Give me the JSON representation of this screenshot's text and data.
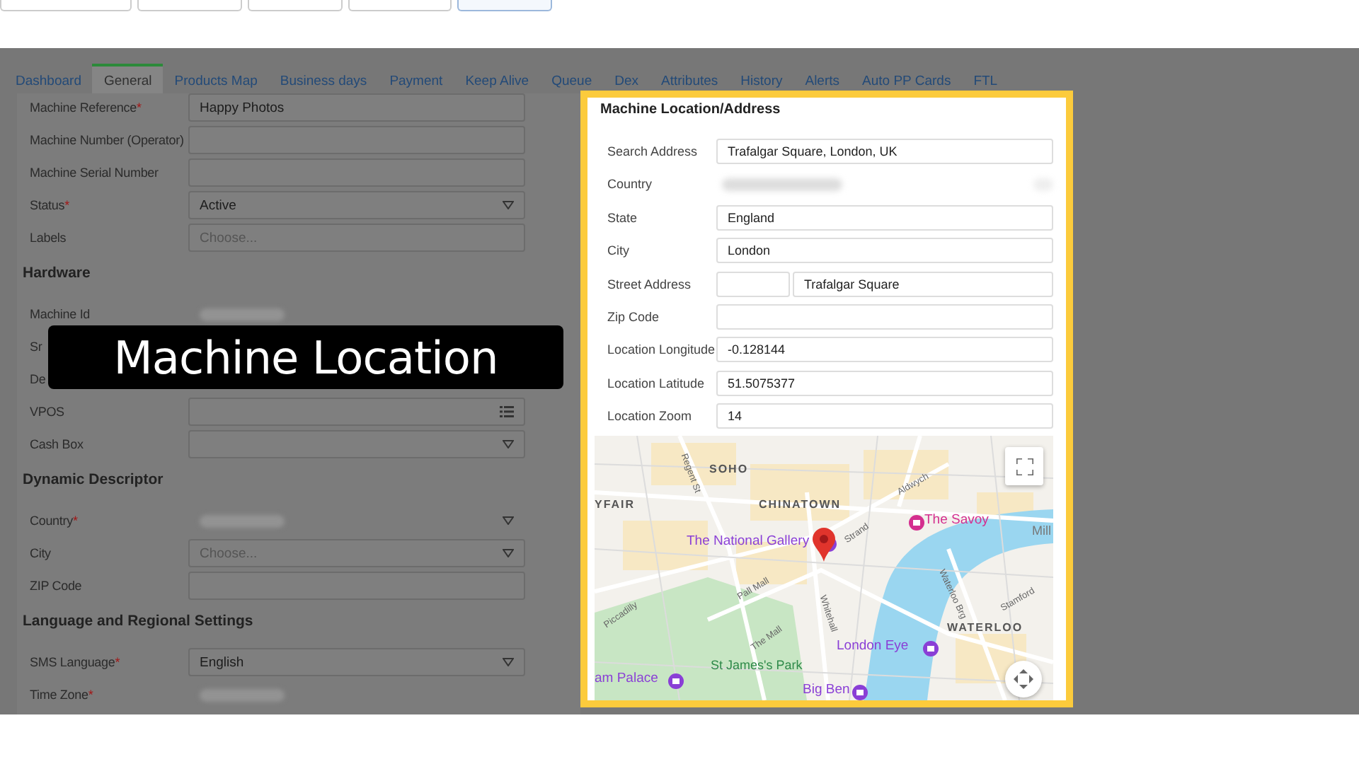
{
  "toolbar_buttons": [
    {
      "selected": false
    },
    {
      "selected": false
    },
    {
      "selected": false
    },
    {
      "selected": false
    },
    {
      "selected": true
    }
  ],
  "tabs": [
    {
      "label": "Dashboard",
      "selected": false
    },
    {
      "label": "General",
      "selected": true
    },
    {
      "label": "Products Map",
      "selected": false
    },
    {
      "label": "Business days",
      "selected": false
    },
    {
      "label": "Payment",
      "selected": false
    },
    {
      "label": "Keep Alive",
      "selected": false
    },
    {
      "label": "Queue",
      "selected": false
    },
    {
      "label": "Dex",
      "selected": false
    },
    {
      "label": "Attributes",
      "selected": false
    },
    {
      "label": "History",
      "selected": false
    },
    {
      "label": "Alerts",
      "selected": false
    },
    {
      "label": "Auto PP Cards",
      "selected": false
    },
    {
      "label": "FTL",
      "selected": false
    }
  ],
  "form": {
    "sections": [
      {
        "fields": [
          {
            "label": "Machine Reference",
            "required_mark": "*",
            "kind": "text",
            "value": "Happy Photos"
          },
          {
            "label": "Machine Number (Operator)",
            "kind": "text"
          },
          {
            "label": "Machine Serial Number",
            "kind": "text"
          },
          {
            "label": "Status",
            "required_mark": "*",
            "kind": "select",
            "value": "Active"
          },
          {
            "label": "Labels",
            "kind": "text",
            "placeholder": "Choose..."
          }
        ]
      },
      {
        "heading": "Hardware",
        "fields": [
          {
            "label": "Machine Id",
            "kind": "redacted"
          },
          {
            "label": "Sr",
            "kind": "covered"
          },
          {
            "label": "De",
            "kind": "covered"
          },
          {
            "label": "VPOS",
            "kind": "list"
          },
          {
            "label": "Cash Box",
            "kind": "select"
          }
        ]
      },
      {
        "heading": "Dynamic Descriptor",
        "fields": [
          {
            "label": "Country",
            "required_mark": "*",
            "kind": "redacted-select"
          },
          {
            "label": "City",
            "kind": "select",
            "placeholder": "Choose..."
          },
          {
            "label": "ZIP Code",
            "kind": "text"
          }
        ]
      },
      {
        "heading": "Language and Regional Settings",
        "fields": [
          {
            "label": "SMS Language",
            "required_mark": "*",
            "kind": "select",
            "value": "English"
          },
          {
            "label": "Time Zone",
            "required_mark": "*",
            "kind": "redacted"
          }
        ]
      }
    ]
  },
  "caption": "Machine Location",
  "location_panel": {
    "title": "Machine Location/Address",
    "fields": [
      {
        "label": "Search Address",
        "kind": "text",
        "value": "Trafalgar Square, London, UK"
      },
      {
        "label": "Country",
        "kind": "redacted"
      },
      {
        "label": "State",
        "kind": "text",
        "value": "England"
      },
      {
        "label": "City",
        "kind": "text",
        "value": "London"
      },
      {
        "label": "Street Address",
        "kind": "split",
        "value": "Trafalgar Square"
      },
      {
        "label": "Zip Code",
        "kind": "text"
      },
      {
        "label": "Location Longitude",
        "kind": "text",
        "value": "-0.128144"
      },
      {
        "label": "Location Latitude",
        "kind": "text",
        "value": "51.5075377"
      },
      {
        "label": "Location Zoom",
        "kind": "text",
        "value": "14"
      }
    ],
    "map": {
      "labels": [
        {
          "text": "SOHO",
          "kind": "area"
        },
        {
          "text": "CHINATOWN",
          "kind": "area"
        },
        {
          "text": "YFAIR",
          "kind": "area"
        },
        {
          "text": "The National Gallery",
          "kind": "place"
        },
        {
          "text": "The Savoy",
          "kind": "hotel"
        },
        {
          "text": "Mill",
          "kind": "cut"
        },
        {
          "text": "WATERLOO",
          "kind": "area"
        },
        {
          "text": "London Eye",
          "kind": "place"
        },
        {
          "text": "St James's Park",
          "kind": "park"
        },
        {
          "text": "am Palace",
          "kind": "place"
        },
        {
          "text": "Big Ben",
          "kind": "place"
        },
        {
          "text": "Regent St",
          "kind": "street"
        },
        {
          "text": "Strand",
          "kind": "street"
        },
        {
          "text": "Aldwych",
          "kind": "street"
        },
        {
          "text": "Pall Mall",
          "kind": "street"
        },
        {
          "text": "The Mall",
          "kind": "street"
        },
        {
          "text": "Whitehall",
          "kind": "street"
        },
        {
          "text": "Piccadilly",
          "kind": "street"
        },
        {
          "text": "Waterloo Brg",
          "kind": "street"
        },
        {
          "text": "Stamford",
          "kind": "street"
        }
      ]
    }
  }
}
